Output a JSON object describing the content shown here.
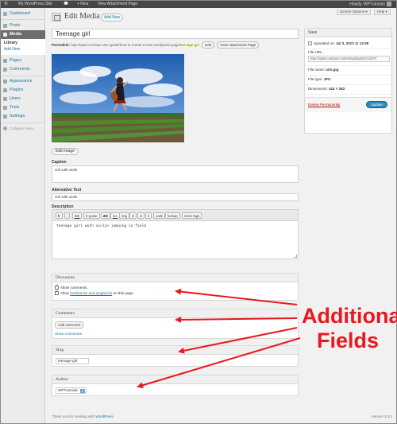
{
  "admin_bar": {
    "site_name": "My WordPress Site",
    "new_label": "+ New",
    "view_attachment": "View Attachment Page",
    "greeting": "Howdy, WPTutorials"
  },
  "sidebar": {
    "items": [
      {
        "label": "Dashboard",
        "icon": "dashboard-icon"
      },
      {
        "label": "Posts",
        "icon": "pin-icon"
      },
      {
        "label": "Media",
        "icon": "media-icon"
      },
      {
        "label": "Pages",
        "icon": "page-icon"
      },
      {
        "label": "Comments",
        "icon": "comment-icon"
      },
      {
        "label": "Appearance",
        "icon": "brush-icon"
      },
      {
        "label": "Plugins",
        "icon": "plug-icon"
      },
      {
        "label": "Users",
        "icon": "user-icon"
      },
      {
        "label": "Tools",
        "icon": "wrench-icon"
      },
      {
        "label": "Settings",
        "icon": "settings-icon"
      },
      {
        "label": "Collapse menu",
        "icon": "collapse-icon"
      }
    ],
    "submenu": {
      "library": "Library",
      "add_new": "Add New"
    }
  },
  "header": {
    "title": "Edit Media",
    "add_new": "Add New",
    "screen_options": "Screen Options ▾",
    "help": "Help ▾"
  },
  "post": {
    "title": "Teenage girl",
    "permalink_label": "Permalink:",
    "permalink_base": "http://wptd.com/wp-user-guide/how-to-create-a-new-wordpress-page/",
    "permalink_slug": "teenage-girl",
    "edit_btn": "Edit",
    "view_btn": "View Attachment Page",
    "edit_image": "Edit Image"
  },
  "fields": {
    "caption_label": "Caption",
    "caption_value": "Girl with violin",
    "alt_label": "Alternative Text",
    "alt_value": "Girl with violin",
    "description_label": "Description",
    "description_value": "Teenage girl with violin jumping in field",
    "quicktags": [
      "b",
      "i",
      "link",
      "b-quote",
      "del",
      "ins",
      "img",
      "ul",
      "ol",
      "li",
      "code",
      "lookup",
      "close tags"
    ]
  },
  "discussion": {
    "title": "Discussion",
    "allow_comments": "Allow comments.",
    "allow_prefix": "Allow",
    "allow_link": "trackbacks and pingbacks",
    "allow_suffix": "on this page."
  },
  "comments": {
    "title": "Comments",
    "add_comment": "Add comment",
    "show_comments": "Show comments"
  },
  "slug": {
    "title": "Slug",
    "value": "teenage-girl"
  },
  "author": {
    "title": "Author",
    "value": "WPTutorials"
  },
  "save": {
    "title": "Save",
    "uploaded_prefix": "Uploaded on:",
    "uploaded_date": "Jul 3, 2013 @ 13:09",
    "file_url_label": "File URL:",
    "file_url_value": "http://wptd.com/wp-content/uploads/2013/07/",
    "file_name_label": "File name:",
    "file_name_value": "arts.jpg",
    "file_type_label": "File type:",
    "file_type_value": "JPG",
    "dimensions_label": "Dimensions:",
    "dimensions_value": "424 × 283",
    "delete": "Delete Permanently",
    "update": "Update"
  },
  "footer": {
    "thanks_prefix": "Thank you for creating with",
    "thanks_link": "WordPress.",
    "version": "Version 3.5.2"
  },
  "annotation": {
    "line1": "Additional",
    "line2": "Fields",
    "color": "#e8191f"
  }
}
